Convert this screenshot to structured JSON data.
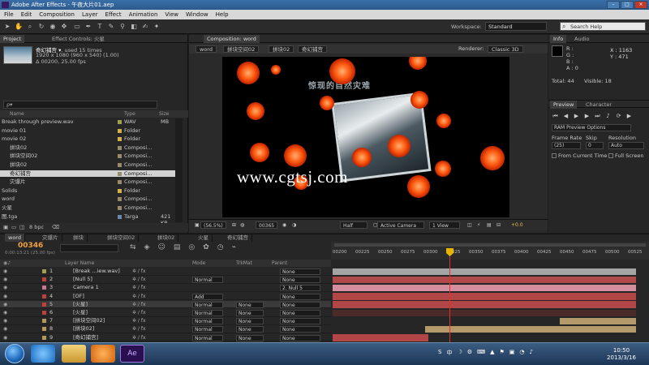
{
  "window": {
    "title": "Adobe After Effects - 午夜大片01.aep"
  },
  "menu": [
    "File",
    "Edit",
    "Composition",
    "Layer",
    "Effect",
    "Animation",
    "View",
    "Window",
    "Help"
  ],
  "workspace": {
    "label": "Workspace:",
    "value": "Standard"
  },
  "search_help": {
    "placeholder": "Search Help"
  },
  "project_panel": {
    "tabs": [
      "Project",
      "Effect Controls: 火星"
    ],
    "selected_item": {
      "name": "奇幻捕宫 ▾",
      "used": ", used 15 times",
      "size": "1920 x 1080  (960 x 540) (1.00)",
      "duration": "Δ 00200, 25.00 fps"
    },
    "search_placeholder": "ρ▾",
    "columns": {
      "name": "Name",
      "type": "Type",
      "size": "Size"
    },
    "items": [
      {
        "name": "Break through preview.wav",
        "type": "WAV",
        "size": "MB",
        "color": "#a0a050"
      },
      {
        "name": "movie 01",
        "type": "Folder",
        "size": "",
        "color": "#d4b04a"
      },
      {
        "name": "movie 02",
        "type": "Folder",
        "size": "",
        "color": "#d4b04a"
      },
      {
        "name": "拼块02",
        "type": "Composi...",
        "size": "",
        "color": "#9a8a6a"
      },
      {
        "name": "拼块空间02",
        "type": "Composi...",
        "size": "",
        "color": "#9a8a6a"
      },
      {
        "name": "拼块02",
        "type": "Composi...",
        "size": "",
        "color": "#9a8a6a"
      },
      {
        "name": "奇幻捕宫",
        "type": "Composi...",
        "size": "",
        "color": "#9a8a6a"
      },
      {
        "name": "灾爆片",
        "type": "Composi...",
        "size": "",
        "color": "#9a8a6a"
      },
      {
        "name": "Solids",
        "type": "Folder",
        "size": "",
        "color": "#d4b04a"
      },
      {
        "name": "word",
        "type": "Composi...",
        "size": "",
        "color": "#9a8a6a"
      },
      {
        "name": "火星",
        "type": "Composi...",
        "size": "",
        "color": "#9a8a6a"
      },
      {
        "name": "图.tga",
        "type": "Targa",
        "size": "421 KB",
        "color": "#6a8ab0"
      }
    ],
    "bpc": "8 bpc"
  },
  "composition_panel": {
    "tab": "Composition: word",
    "breadcrumbs": [
      "word",
      "拼块空间02",
      "拼块02",
      "奇幻捕宫"
    ],
    "renderer": "Renderer:",
    "renderer_value": "Classic 3D",
    "overlay_title": "惊现的自然灾难",
    "watermark": "www.cgtsj.com",
    "zoom": "(56.5%)",
    "timecode": "00365",
    "resolution": "Half",
    "camera": "Active Camera",
    "views": "1 View",
    "exposure": "+0.0"
  },
  "info_panel": {
    "tabs": [
      "Info",
      "Audio"
    ],
    "r": "R :",
    "g": "G :",
    "b": "B :",
    "a": "A : 0",
    "x": "X : 1163",
    "y": "Y : 471",
    "total": "Total: 44",
    "visible": "Visible: 18"
  },
  "preview_panel": {
    "tabs": [
      "Preview",
      "Character"
    ],
    "options": "RAM Preview Options",
    "frame_rate_label": "Frame Rate",
    "skip_label": "Skip",
    "resolution_label": "Resolution",
    "frame_rate": "(25)",
    "skip": "0",
    "resolution": "Auto",
    "from_current": "From Current Time",
    "full_screen": "Full Screen"
  },
  "timeline": {
    "tabs": [
      "word",
      "灾爆片",
      "拼块",
      "拼块空间02",
      "拼块02",
      "火星",
      "奇幻捕宫"
    ],
    "timecode": "00346",
    "fps_note": "0:00:13:21 (25.00 fps)",
    "headers": {
      "layer_name": "Layer Name",
      "mode": "Mode",
      "trkmat": "TrkMat",
      "parent": "Parent"
    },
    "layers": [
      {
        "num": "1",
        "name": "[Break ...iew.wav]",
        "mode": "",
        "trkmat": "",
        "parent": "None",
        "color": "#a0a050"
      },
      {
        "num": "2",
        "name": "[Null 5]",
        "mode": "Normal",
        "trkmat": "",
        "parent": "None",
        "color": "#c04040"
      },
      {
        "num": "3",
        "name": "Camera 1",
        "mode": "",
        "trkmat": "",
        "parent": "2. Null 5",
        "color": "#c87890"
      },
      {
        "num": "4",
        "name": "[OF]",
        "mode": "Add",
        "trkmat": "",
        "parent": "None",
        "color": "#c04040"
      },
      {
        "num": "5",
        "name": "[火星]",
        "mode": "Normal",
        "trkmat": "None",
        "parent": "None",
        "color": "#c04040"
      },
      {
        "num": "6",
        "name": "[火星]",
        "mode": "Normal",
        "trkmat": "None",
        "parent": "None",
        "color": "#c04040"
      },
      {
        "num": "7",
        "name": "[拼块空间02]",
        "mode": "Normal",
        "trkmat": "None",
        "parent": "None",
        "color": "#b49a5a"
      },
      {
        "num": "8",
        "name": "[拼块02]",
        "mode": "Normal",
        "trkmat": "None",
        "parent": "None",
        "color": "#b49a5a"
      },
      {
        "num": "9",
        "name": "[奇幻捕宫]",
        "mode": "Normal",
        "trkmat": "None",
        "parent": "None",
        "color": "#b49a5a"
      }
    ],
    "ruler": [
      "00200",
      "00225",
      "00250",
      "00275",
      "00300",
      "00325",
      "00350",
      "00375",
      "00400",
      "00425",
      "00450",
      "00475",
      "00500",
      "00525"
    ]
  },
  "taskbar": {
    "time": "10:50",
    "date": "2013/3/16"
  }
}
